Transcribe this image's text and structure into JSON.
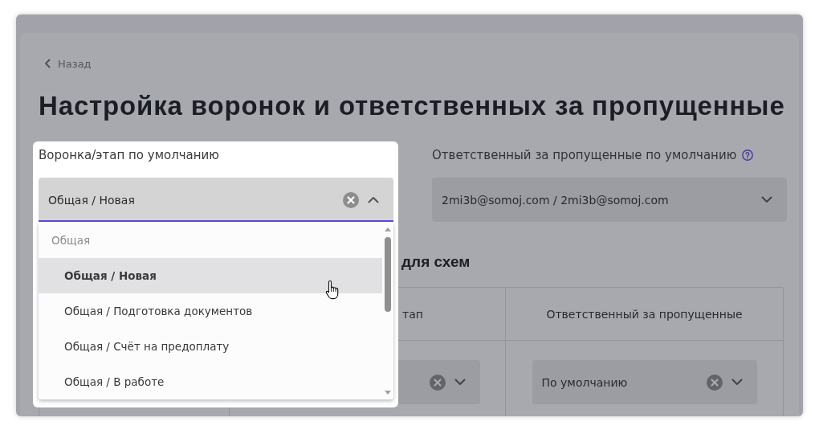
{
  "back_link": {
    "label": "Назад"
  },
  "title": "Настройка воронок и ответственных за пропущенные",
  "fields": [
    {
      "label": "Воронка/этап по умолчанию",
      "value": "Общая / Новая",
      "clear_button": true,
      "expanded": true,
      "highlighted": true,
      "options": [
        {
          "kind": "group",
          "label": "Общая"
        },
        {
          "kind": "option",
          "label": "Общая / Новая",
          "selected": true,
          "hovered": true
        },
        {
          "kind": "option",
          "label": "Общая / Подготовка документов",
          "selected": false,
          "hovered": false
        },
        {
          "kind": "option",
          "label": "Общая / Счёт на предоплату",
          "selected": false,
          "hovered": false
        },
        {
          "kind": "option",
          "label": "Общая / В работе",
          "selected": false,
          "hovered": false
        }
      ]
    },
    {
      "label": "Ответственный за пропущенные по умолчанию",
      "help": true,
      "value": "2mi3b@somoj.com / 2mi3b@somoj.com",
      "expanded": false
    }
  ],
  "section_heading": "для схем",
  "table": {
    "columns": [
      {},
      {
        "label": "тап"
      },
      {
        "label": "Ответственный за пропущенные"
      }
    ],
    "rows": [
      {
        "cells": [
          {},
          {
            "kind": "select",
            "clear_button": true,
            "expanded": false
          },
          {
            "kind": "select",
            "value": "По умолчанию",
            "clear_button": true,
            "expanded": false
          }
        ]
      }
    ]
  }
}
